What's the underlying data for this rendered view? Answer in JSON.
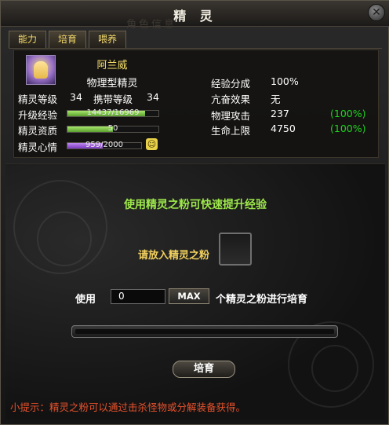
{
  "window": {
    "title": "精 灵",
    "ghost_title": "角色信息",
    "close_label": "✕"
  },
  "tabs": [
    {
      "label": "能力",
      "active": false
    },
    {
      "label": "培育",
      "active": true
    },
    {
      "label": "喂养",
      "active": false
    }
  ],
  "spirit": {
    "name": "阿兰威",
    "type": "物理型精灵",
    "level_label": "精灵等级",
    "level": "34",
    "carry_level_label": "携带等级",
    "carry_level": "34",
    "exp_label": "升级经验",
    "exp_text": "14437/16969",
    "exp_fraction": 0.85,
    "aptitude_label": "精灵资质",
    "aptitude_text": "50",
    "aptitude_fraction": 0.5,
    "mood_label": "精灵心情",
    "mood_text": "959/2000",
    "mood_fraction": 0.48,
    "mood_icon": "smile-face-icon"
  },
  "stats": [
    {
      "label": "经验分成",
      "value": "100%",
      "bonus": ""
    },
    {
      "label": "亢奋效果",
      "value": "无",
      "bonus": ""
    },
    {
      "label": "物理攻击",
      "value": "237",
      "bonus": "(100%)"
    },
    {
      "label": "生命上限",
      "value": "4750",
      "bonus": "(100%)"
    }
  ],
  "cultivate": {
    "hint": "使用精灵之粉可快速提升经验",
    "put_label": "请放入精灵之粉",
    "use_label": "使用",
    "quantity": "0",
    "max_label": "MAX",
    "after_label": "个精灵之粉进行培育",
    "progress_fraction": 0.0,
    "button_label": "培育"
  },
  "tip": "小提示：精灵之粉可以通过击杀怪物或分解装备获得。",
  "colors": {
    "accent_gold": "#f2d86a",
    "green": "#1ed41e",
    "tip_red": "#e8522c",
    "exp_bar": "#7cd04a",
    "mood_bar": "#9a5ad8"
  }
}
